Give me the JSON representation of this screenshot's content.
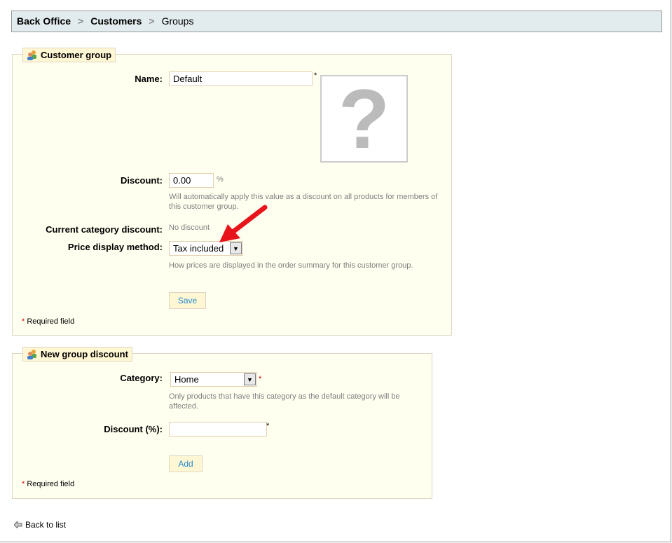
{
  "breadcrumb": [
    "Back Office",
    "Customers",
    "Groups"
  ],
  "customer_group": {
    "legend": "Customer group",
    "name_label": "Name:",
    "name_value": "Default",
    "discount_label": "Discount:",
    "discount_value": "0.00",
    "discount_unit": "%",
    "discount_hint": "Will automatically apply this value as a discount on all products for members of this customer group.",
    "current_label": "Current category discount:",
    "current_value": "No discount",
    "price_label": "Price display method:",
    "price_value": "Tax included",
    "price_hint": "How prices are displayed in the order summary for this customer group.",
    "save": "Save",
    "required": "Required field",
    "asterisk": "*"
  },
  "new_discount": {
    "legend": "New group discount",
    "category_label": "Category:",
    "category_value": "Home",
    "category_hint": "Only products that have this category as the default category will be affected.",
    "discount_label": "Discount (%):",
    "discount_value": "",
    "add": "Add",
    "required": "Required field",
    "asterisk": "*"
  },
  "back_link": "Back to list"
}
